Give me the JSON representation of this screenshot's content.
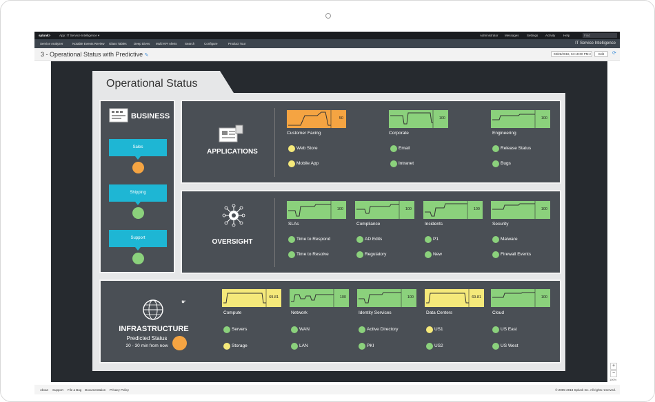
{
  "topbar": {
    "logo": "splunk>",
    "app": "App: IT Service Intelligence",
    "right": [
      "Administrator",
      "Messages",
      "Settings",
      "Activity",
      "Help"
    ],
    "find": "Find"
  },
  "nav": {
    "items": [
      "Service Analyzer",
      "Notable Events Review",
      "Glass Tables",
      "Deep Dives",
      "Multi KPI Alerts",
      "Search",
      "Configure",
      "Product Tour"
    ],
    "brand": "IT Service Intelligence"
  },
  "page": {
    "title": "3 - Operational Status with Predictive",
    "time": "03/26/2018, 04:19:00 PM",
    "edit": "Edit"
  },
  "board": {
    "title": "Operational Status",
    "business": {
      "title": "BUSINESS",
      "items": [
        {
          "label": "Sales",
          "status": "orange"
        },
        {
          "label": "Shipping",
          "status": "green"
        },
        {
          "label": "Support",
          "status": "green"
        }
      ]
    },
    "applications": {
      "title": "APPLICATIONS",
      "kpis": [
        {
          "name": "Customer Facing",
          "value": "50",
          "color": "#f5a442",
          "items": [
            {
              "label": "Web Store",
              "status": "yellow"
            },
            {
              "label": "Mobile App",
              "status": "yellow"
            }
          ]
        },
        {
          "name": "Corporate",
          "value": "100",
          "color": "#8bd17c",
          "items": [
            {
              "label": "Email",
              "status": "green"
            },
            {
              "label": "Intranet",
              "status": "green"
            }
          ]
        },
        {
          "name": "Engineering",
          "value": "100",
          "color": "#8bd17c",
          "items": [
            {
              "label": "Release Status",
              "status": "green"
            },
            {
              "label": "Bugs",
              "status": "green"
            }
          ]
        }
      ]
    },
    "oversight": {
      "title": "OVERSIGHT",
      "kpis": [
        {
          "name": "SLAs",
          "value": "100",
          "color": "#8bd17c",
          "items": [
            {
              "label": "Time to Respond",
              "status": "green"
            },
            {
              "label": "Time to Resolve",
              "status": "green"
            }
          ]
        },
        {
          "name": "Compliance",
          "value": "100",
          "color": "#8bd17c",
          "items": [
            {
              "label": "AD Edits",
              "status": "green"
            },
            {
              "label": "Regulatory",
              "status": "green"
            }
          ]
        },
        {
          "name": "Incidents",
          "value": "100",
          "color": "#8bd17c",
          "items": [
            {
              "label": "P1",
              "status": "green"
            },
            {
              "label": "New",
              "status": "green"
            }
          ]
        },
        {
          "name": "Security",
          "value": "100",
          "color": "#8bd17c",
          "items": [
            {
              "label": "Malware",
              "status": "green"
            },
            {
              "label": "Firewall Events",
              "status": "green"
            }
          ]
        }
      ]
    },
    "infrastructure": {
      "title": "INFRASTRUCTURE",
      "subtitle": "Predicted Status",
      "window": "20 - 30 min from now",
      "predicted_status": "orange",
      "kpis": [
        {
          "name": "Compute",
          "value": "69.81",
          "color": "#f5e97a",
          "items": [
            {
              "label": "Servers",
              "status": "green"
            },
            {
              "label": "Storage",
              "status": "yellow"
            }
          ]
        },
        {
          "name": "Network",
          "value": "100",
          "color": "#8bd17c",
          "items": [
            {
              "label": "WAN",
              "status": "green"
            },
            {
              "label": "LAN",
              "status": "green"
            }
          ]
        },
        {
          "name": "Identity Services",
          "value": "100",
          "color": "#8bd17c",
          "items": [
            {
              "label": "Active Directory",
              "status": "green"
            },
            {
              "label": "PKI",
              "status": "green"
            }
          ]
        },
        {
          "name": "Data Centers",
          "value": "69.81",
          "color": "#f5e97a",
          "items": [
            {
              "label": "US1",
              "status": "yellow"
            },
            {
              "label": "US2",
              "status": "green"
            }
          ]
        },
        {
          "name": "Cloud",
          "value": "100",
          "color": "#8bd17c",
          "items": [
            {
              "label": "US East",
              "status": "green"
            },
            {
              "label": "US West",
              "status": "green"
            }
          ]
        }
      ]
    }
  },
  "status_colors": {
    "green": "#8bd17c",
    "yellow": "#f5e97a",
    "orange": "#f5a442"
  },
  "zoom": {
    "in": "+",
    "out": "−",
    "level": "100%"
  },
  "footer": {
    "links": [
      "About",
      "Support",
      "File a Bug",
      "Documentation",
      "Privacy Policy"
    ],
    "copyright": "© 2005-2018 Splunk Inc. All rights reserved."
  }
}
